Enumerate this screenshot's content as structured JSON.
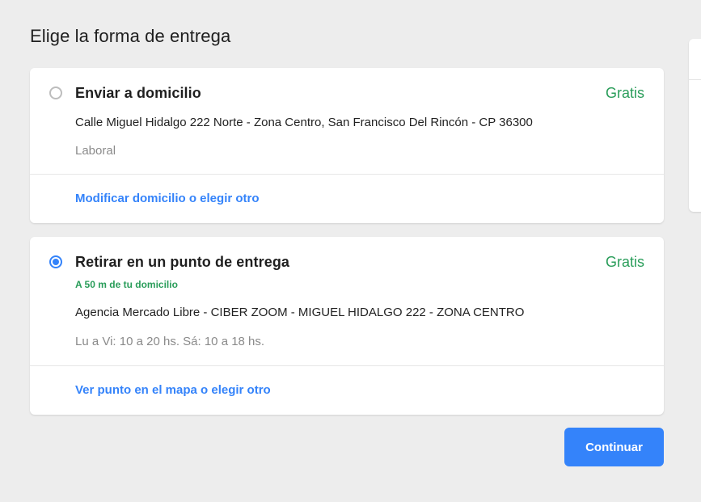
{
  "page": {
    "title": "Elige la forma de entrega"
  },
  "options": [
    {
      "title": "Enviar a domicilio",
      "price": "Gratis",
      "address": "Calle Miguel Hidalgo 222 Norte - Zona Centro, San Francisco Del Rincón - CP 36300",
      "label": "Laboral",
      "link": "Modificar domicilio o elegir otro",
      "selected": false
    },
    {
      "title": "Retirar en un punto de entrega",
      "price": "Gratis",
      "distance": "A 50 m de tu domicilio",
      "address": "Agencia Mercado Libre - CIBER ZOOM - MIGUEL HIDALGO 222 - ZONA CENTRO",
      "hours": "Lu a Vi: 10 a 20 hs. Sá: 10 a 18 hs.",
      "link": "Ver punto en el mapa o elegir otro",
      "selected": true
    }
  ],
  "actions": {
    "continue_label": "Continuar"
  },
  "colors": {
    "accent": "#3483fa",
    "free_price": "#2a9d5a",
    "background": "#ededed"
  }
}
